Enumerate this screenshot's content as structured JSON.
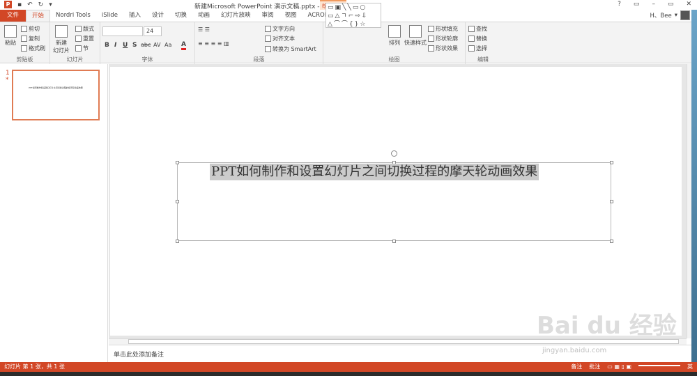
{
  "window": {
    "title": "新建Microsoft PowerPoint 演示文稿.pptx - PowerPoint",
    "context_group": "绘图工具",
    "controls": [
      "?",
      "▭",
      "–",
      "▭",
      "✕"
    ]
  },
  "qat": {
    "app_icon": "P"
  },
  "tabs": [
    "文件",
    "开始",
    "Nordri Tools",
    "iSlide",
    "插入",
    "设计",
    "切换",
    "动画",
    "幻灯片放映",
    "审阅",
    "视图",
    "ACROBAT",
    "格式"
  ],
  "user": {
    "name": "H、Bee"
  },
  "ribbon": {
    "clipboard": {
      "label": "剪贴板",
      "paste": "粘贴",
      "cut": "剪切",
      "copy": "复制",
      "format_painter": "格式刷"
    },
    "slides": {
      "label": "幻灯片",
      "new_slide": "新建\n幻灯片",
      "layout": "版式",
      "reset": "重置",
      "section": "节"
    },
    "font": {
      "label": "字体",
      "font_name": "",
      "font_size": "24",
      "bold": "B",
      "italic": "I",
      "underline": "U",
      "shadow": "S",
      "strike": "abc",
      "spacing": "AV",
      "case": "Aa",
      "color": "A"
    },
    "paragraph": {
      "label": "段落",
      "text_direction": "文字方向",
      "align_text": "对齐文本",
      "smartart": "转换为 SmartArt"
    },
    "drawing": {
      "label": "绘图",
      "arrange": "排列",
      "quick_styles": "快速样式",
      "shape_fill": "形状填充",
      "shape_outline": "形状轮廓",
      "shape_effects": "形状效果"
    },
    "editing": {
      "label": "编辑",
      "find": "查找",
      "replace": "替换",
      "select": "选择"
    }
  },
  "thumbnail": {
    "number": "1",
    "star": "*",
    "text": "PPT如何制作和设置幻灯片之间切换过程的摩天轮动画效果"
  },
  "slide": {
    "title": "PPT如何制作和设置幻灯片之间切换过程的摩天轮动画效果"
  },
  "notes": {
    "placeholder": "单击此处添加备注"
  },
  "status": {
    "left": "幻灯片 第 1 张，共 1 张",
    "notes": "备注",
    "comments": "批注",
    "lang": "英"
  },
  "watermark": {
    "text": "Bai du 经验",
    "url": "jingyan.baidu.com"
  }
}
